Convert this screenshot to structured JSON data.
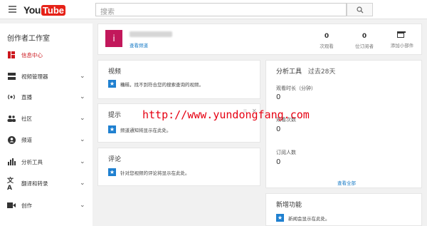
{
  "header": {
    "logo_you": "You",
    "logo_tube": "Tube",
    "search_placeholder": "搜索"
  },
  "sidebar": {
    "title": "创作者工作室",
    "items": [
      {
        "label": "信息中心",
        "icon": "dashboard-icon",
        "active": true,
        "chevron": false
      },
      {
        "label": "视频管理器",
        "icon": "video-manager-icon",
        "active": false,
        "chevron": true
      },
      {
        "label": "直播",
        "icon": "live-icon",
        "active": false,
        "chevron": true
      },
      {
        "label": "社区",
        "icon": "community-icon",
        "active": false,
        "chevron": true
      },
      {
        "label": "频道",
        "icon": "channel-icon",
        "active": false,
        "chevron": true
      },
      {
        "label": "分析工具",
        "icon": "analytics-icon",
        "active": false,
        "chevron": true
      },
      {
        "label": "翻译和转录",
        "icon": "translate-icon",
        "active": false,
        "chevron": true
      },
      {
        "label": "创作",
        "icon": "create-icon",
        "active": false,
        "chevron": true
      }
    ]
  },
  "channel": {
    "avatar_letter": "i",
    "view_channel": "查看频道",
    "stats": [
      {
        "value": "0",
        "label": "次观看"
      },
      {
        "value": "0",
        "label": "位订阅者"
      }
    ],
    "add_widget": "添加小部件"
  },
  "videos": {
    "title": "视频",
    "note": "糟糕，找不到符合您的搜索查询的视频。"
  },
  "tips": {
    "title": "提示",
    "note": "频道通知将显示在此处。"
  },
  "comments": {
    "title": "评论",
    "note": "针对您视频的评论将显示在此处。"
  },
  "analytics": {
    "title": "分析工具",
    "period": "过去28天",
    "metrics": [
      {
        "label": "观看时长（分钟）",
        "value": "0"
      },
      {
        "label": "观看次数",
        "value": "0"
      },
      {
        "label": "订阅人数",
        "value": "0"
      }
    ],
    "view_all": "查看全部"
  },
  "whats_new": {
    "title": "新增功能",
    "note": "新闻会显示在此处。"
  },
  "watermark": "http://www.yundongfang.com",
  "colors": {
    "accent": "#cc181e",
    "avatar": "#c2185b",
    "link": "#167ac6",
    "info": "#1f80d0"
  }
}
